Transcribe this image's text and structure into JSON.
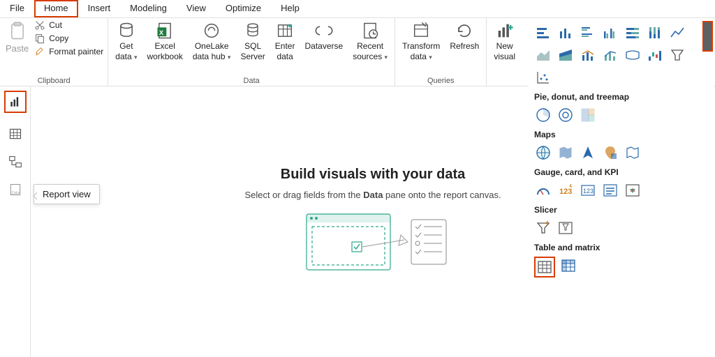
{
  "menu": [
    "File",
    "Home",
    "Insert",
    "Modeling",
    "View",
    "Optimize",
    "Help"
  ],
  "clipboard": {
    "label": "Clipboard",
    "paste": "Paste",
    "cut": "Cut",
    "copy": "Copy",
    "fmt": "Format painter"
  },
  "data_group": {
    "label": "Data",
    "btns": [
      {
        "l1": "Get",
        "l2": "data",
        "dd": true
      },
      {
        "l1": "Excel",
        "l2": "workbook"
      },
      {
        "l1": "OneLake",
        "l2": "data hub",
        "dd": true
      },
      {
        "l1": "SQL",
        "l2": "Server"
      },
      {
        "l1": "Enter",
        "l2": "data"
      },
      {
        "l1": "Dataverse",
        "l2": ""
      },
      {
        "l1": "Recent",
        "l2": "sources",
        "dd": true
      }
    ]
  },
  "queries_group": {
    "label": "Queries",
    "btns": [
      {
        "l1": "Transform",
        "l2": "data",
        "dd": true
      },
      {
        "l1": "Refresh",
        "l2": ""
      }
    ]
  },
  "insert_group": {
    "btns": [
      {
        "l1": "New",
        "l2": "visual"
      }
    ]
  },
  "tooltip": "Report view",
  "canvas": {
    "h": "Build visuals with your data",
    "p1": "Select or drag fields from the ",
    "pb": "Data",
    "p2": " pane onto the report canvas."
  },
  "viz": {
    "cat_pie": "Pie, donut, and treemap",
    "cat_map": "Maps",
    "cat_gauge": "Gauge, card, and KPI",
    "cat_slicer": "Slicer",
    "cat_table": "Table and matrix"
  }
}
